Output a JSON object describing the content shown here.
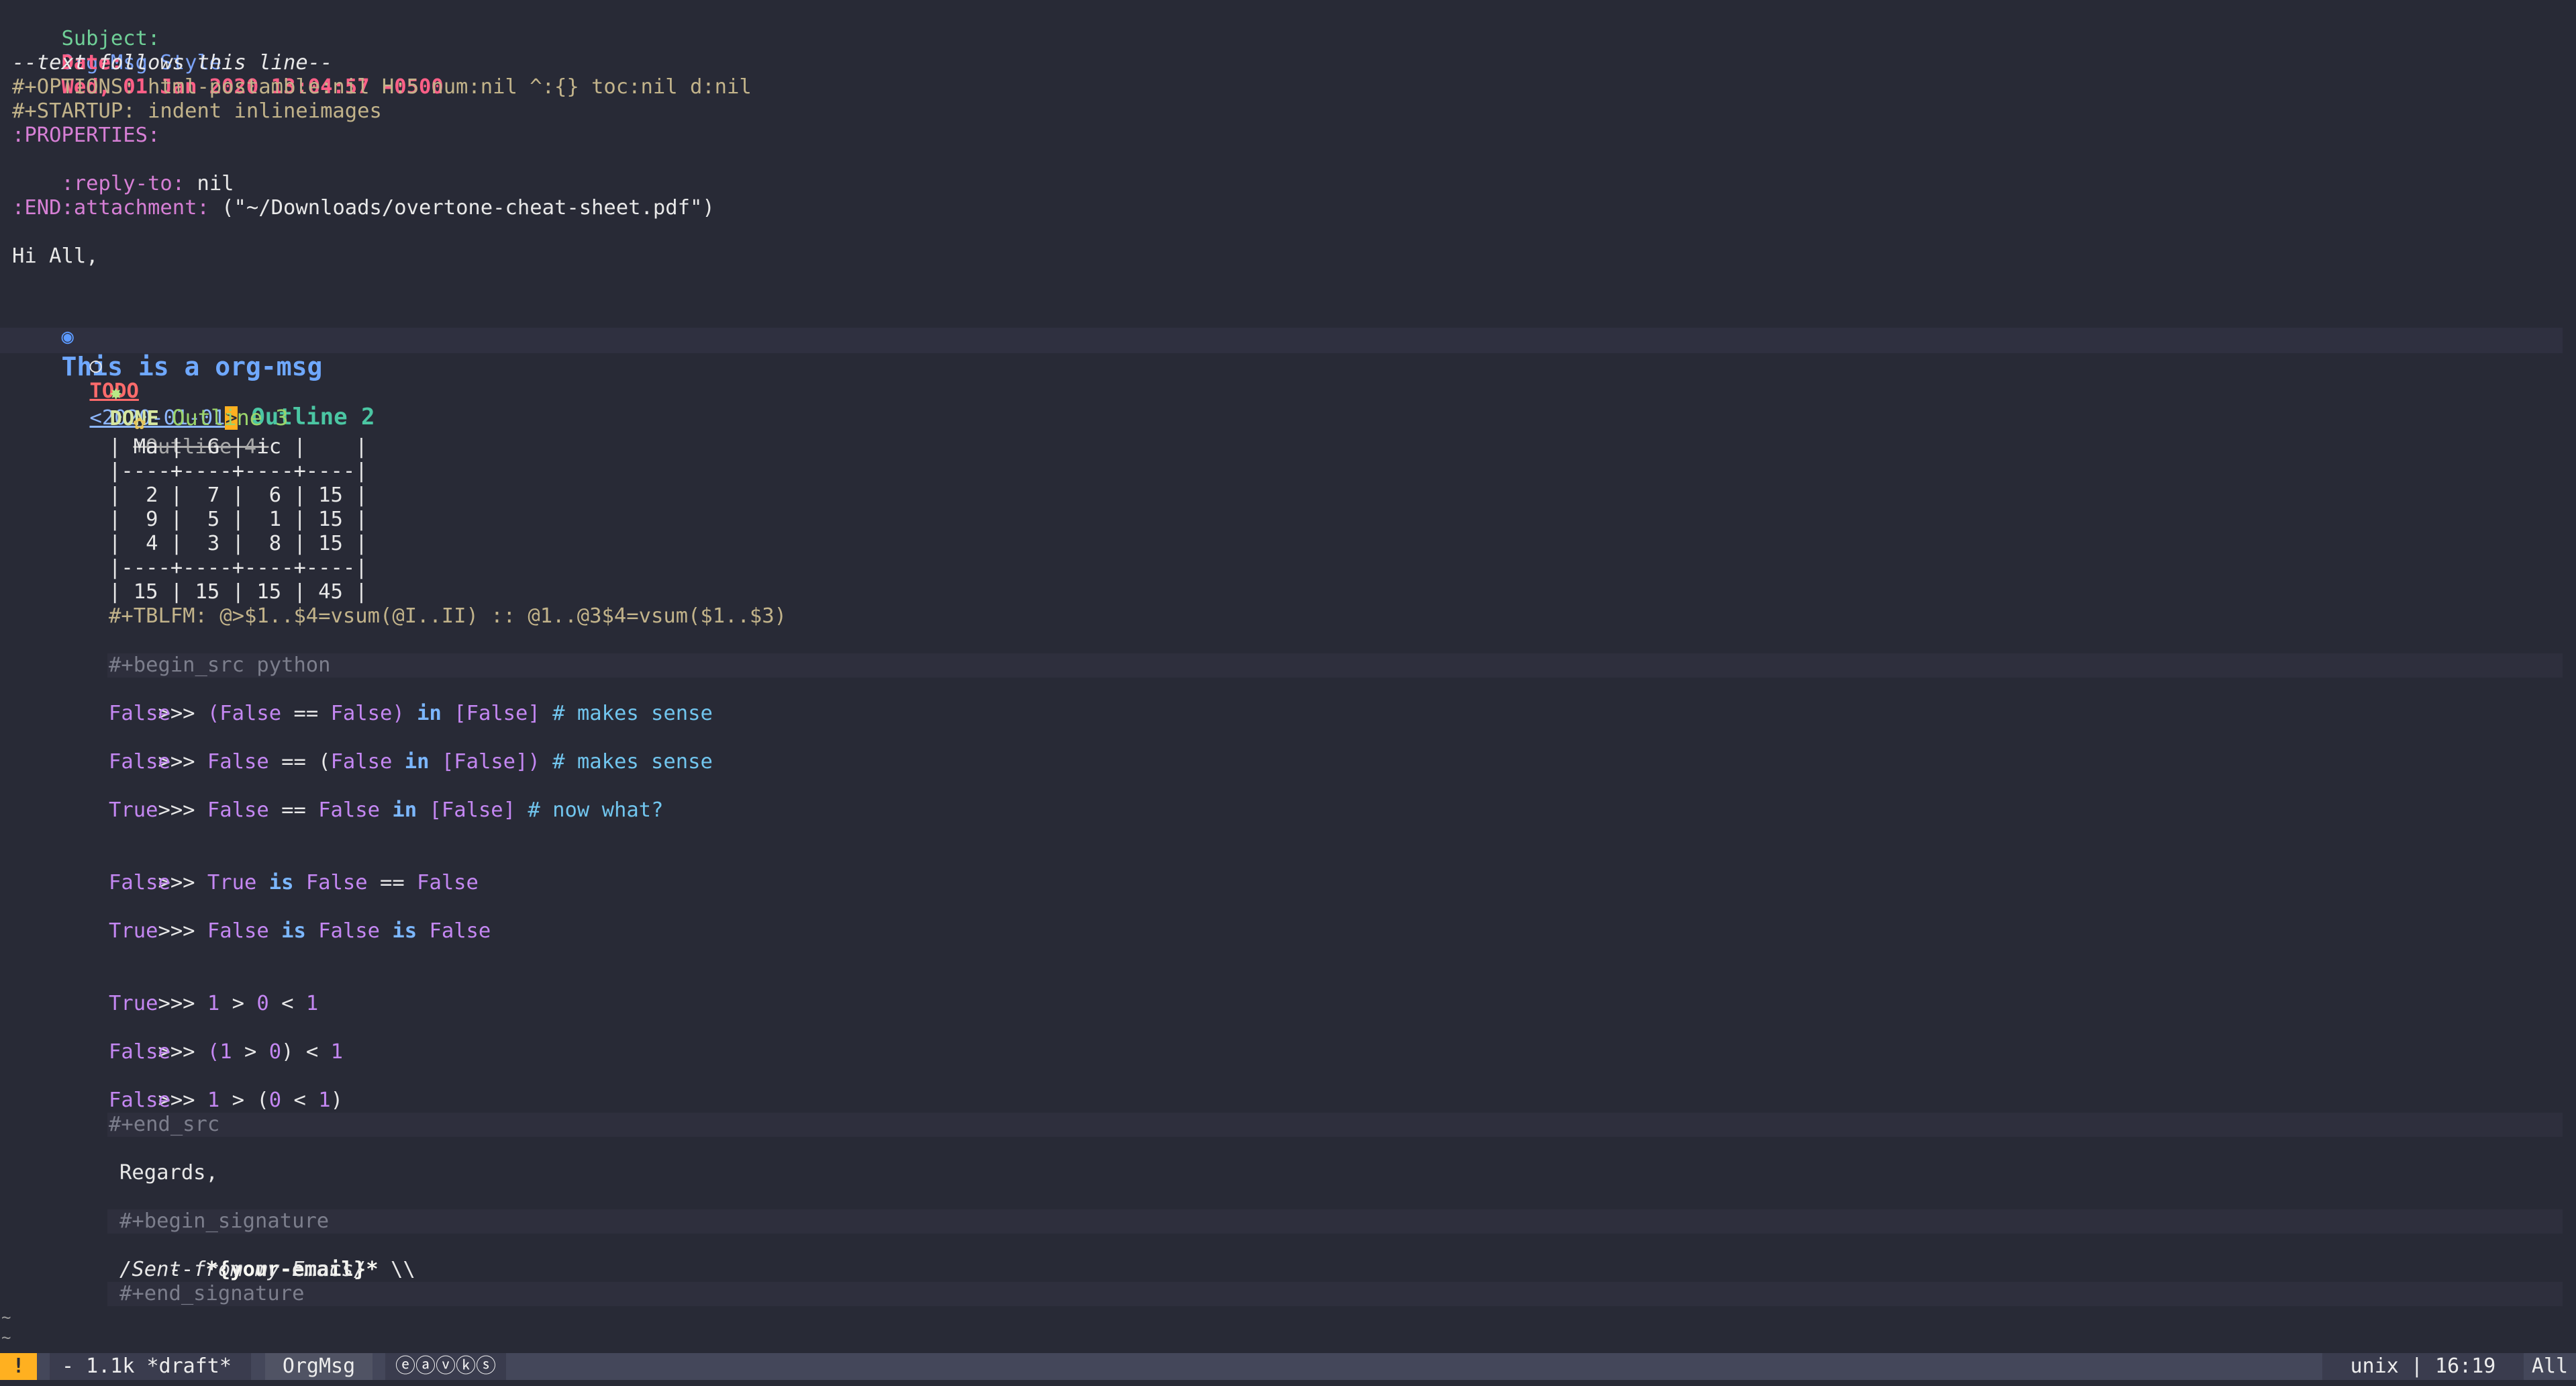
{
  "header": {
    "subject_label": "Subject:",
    "subject_value": "Org-Msg Style",
    "date_label": "Date:",
    "date_value": "Wed, 01 Jan 2020 13:04:57 -0500",
    "separator": "--text follows this line--"
  },
  "directives": {
    "options": "#+OPTIONS: html-postamble:nil H:5 num:nil ^:{} toc:nil d:nil",
    "startup": "#+STARTUP: indent inlineimages",
    "properties": ":PROPERTIES:",
    "reply_to_key": ":reply-to:",
    "reply_to_value": " nil",
    "attachment_key": ":attachment:",
    "attachment_value": " (\"~/Downloads/overtone-cheat-sheet.pdf\")",
    "end": ":END:"
  },
  "greeting": "Hi All,",
  "outline": {
    "h1_bullet": "◉",
    "h1": "This is a org-msg",
    "h2_bullet": "○",
    "h2_todo": "TODO",
    "h2_date": "<2020-01-01",
    "h2_cursor": ">",
    "h2_title": " Outline 2",
    "h3_bullet": "✸",
    "h3_done": "DONE",
    "h3_title": " Outline 3",
    "h4_bullet": "✿",
    "h4_title": "+Outline 4+"
  },
  "table": {
    "rows": [
      "| Ma |  G | ic |    |",
      "|----+----+----+----|",
      "|  2 |  7 |  6 | 15 |",
      "|  9 |  5 |  1 | 15 |",
      "|  4 |  3 |  8 | 15 |",
      "|----+----+----+----|",
      "| 15 | 15 | 15 | 45 |"
    ],
    "tblfm": "#+TBLFM: @>$1..$4=vsum(@I..II) :: @1..@3$4=vsum($1..$3)"
  },
  "src": {
    "begin": "#+begin_src python",
    "end": "#+end_src",
    "l1": {
      "prompt": ">>> ",
      "a": "(",
      "b": "False",
      "c": " == ",
      "d": "False",
      "e": ") ",
      "kw": "in",
      "f": " [",
      "g": "False",
      "h": "] ",
      "comment": "# makes sense"
    },
    "r1": "False",
    "l2": {
      "prompt": ">>> ",
      "a": "False",
      "b": " == (",
      "c": "False",
      "d": " ",
      "kw": "in",
      "e": " [",
      "f": "False",
      "g": "]) ",
      "comment": "# makes sense"
    },
    "r2": "False",
    "l3": {
      "prompt": ">>> ",
      "a": "False",
      "b": " == ",
      "c": "False",
      "d": " ",
      "kw": "in",
      "e": " [",
      "f": "False",
      "g": "] ",
      "comment": "# now what?"
    },
    "r3": "True",
    "l4": {
      "prompt": ">>> ",
      "a": "True",
      "kw": " is ",
      "b": "False",
      "c": " == ",
      "d": "False"
    },
    "r4": "False",
    "l5": {
      "prompt": ">>> ",
      "a": "False",
      "kw1": " is ",
      "b": "False",
      "kw2": " is ",
      "c": "False"
    },
    "r5": "True",
    "l6": {
      "prompt": ">>> ",
      "a": "1",
      "b": " > ",
      "c": "0",
      "d": " < ",
      "e": "1"
    },
    "r6": "True",
    "l7": {
      "prompt": ">>> ",
      "a": "(",
      "b": "1",
      "c": " > ",
      "d": "0",
      "e": ") < ",
      "f": "1"
    },
    "r7": "False",
    "l8": {
      "prompt": ">>> ",
      "a": "1",
      "b": " > (",
      "c": "0",
      "d": " < ",
      "e": "1",
      "f": ")"
    },
    "r8": "False"
  },
  "closing": "Regards,",
  "signature": {
    "begin": "#+begin_signature",
    "line1_a": "-- ",
    "line1_b": "*{your-email}*",
    "line1_c": " \\\\",
    "line2": "/Sent from my Emacs/",
    "end": "#+end_signature"
  },
  "fringe": {
    "tilde1": "~",
    "tilde2": "~"
  },
  "modeline": {
    "warning": "!",
    "info": " - 1.1k *draft*",
    "mode": "OrgMsg",
    "minor": "ⓔⓐⓥⓚⓢ",
    "encoding": "unix | 16:19",
    "position": "All"
  },
  "colors": {
    "background": "#282a36",
    "accent": "#ffb020",
    "modeline": "#44475a"
  }
}
